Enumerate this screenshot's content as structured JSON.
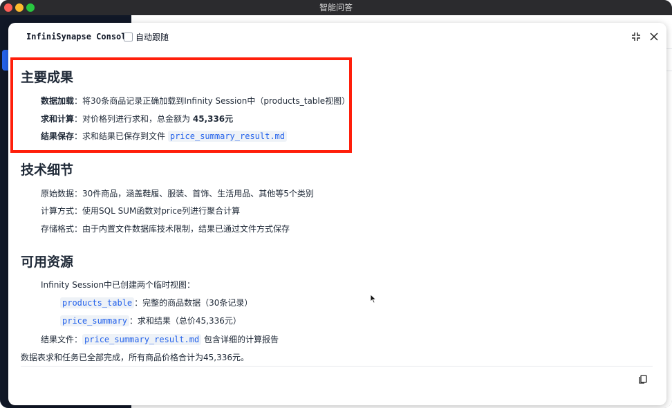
{
  "window": {
    "title": "智能问答"
  },
  "console": {
    "title": "InfiniSynapse Console",
    "follow_label": "自动跟随"
  },
  "sections": {
    "main_results": {
      "heading": "主要成果",
      "data_load_label": "数据加载",
      "data_load_text": "：将30条商品记录正确加载到Infinity Session中（products_table视图）",
      "sum_label": "求和计算",
      "sum_text": "：对价格列进行求和，总金额为 ",
      "sum_value": "45,336元",
      "save_label": "结果保存",
      "save_text": "：求和结果已保存到文件 ",
      "save_file": "price_summary_result.md"
    },
    "tech_details": {
      "heading": "技术细节",
      "items": [
        "原始数据：30件商品，涵盖鞋履、服装、首饰、生活用品、其他等5个类别",
        "计算方式：使用SQL SUM函数对price列进行聚合计算",
        "存储格式：由于内置文件数据库技术限制，结果已通过文件方式保存"
      ]
    },
    "resources": {
      "heading": "可用资源",
      "intro": "Infinity Session中已创建两个临时视图：",
      "view1_code": "products_table",
      "view1_text": "：完整的商品数据（30条记录）",
      "view2_code": "price_summary",
      "view2_text": "：求和结果（总价45,336元）",
      "file_label": "结果文件：",
      "file_code": "price_summary_result.md",
      "file_text": " 包含详细的计算报告"
    },
    "conclusion": "数据表求和任务已全部完成，所有商品价格合计为45,336元。"
  },
  "colors": {
    "highlight_border": "#ff1e0a",
    "code_text": "#2563eb"
  }
}
